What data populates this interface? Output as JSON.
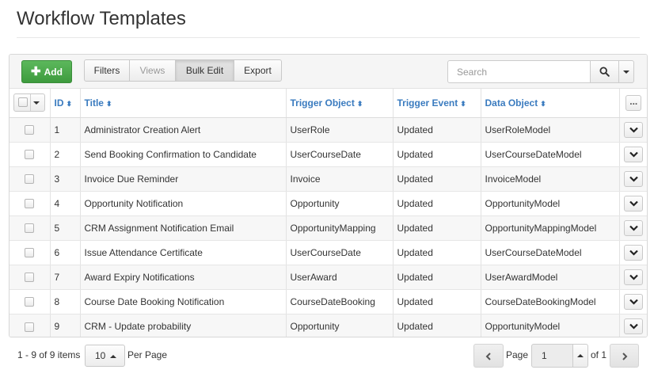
{
  "page": {
    "title": "Workflow Templates"
  },
  "toolbar": {
    "add_label": "Add",
    "filters_label": "Filters",
    "views_label": "Views",
    "bulk_edit_label": "Bulk Edit",
    "export_label": "Export",
    "search_placeholder": "Search",
    "search_value": "",
    "icons": {
      "add": "plus-icon",
      "search": "search-icon",
      "search_options": "caret-down-icon"
    }
  },
  "table": {
    "columns": [
      "ID",
      "Title",
      "Trigger Object",
      "Trigger Event",
      "Data Object"
    ],
    "more_label": "...",
    "rows": [
      {
        "id": "1",
        "title": "Administrator Creation Alert",
        "trigger_object": "UserRole",
        "trigger_event": "Updated",
        "data_object": "UserRoleModel"
      },
      {
        "id": "2",
        "title": "Send Booking Confirmation to Candidate",
        "trigger_object": "UserCourseDate",
        "trigger_event": "Updated",
        "data_object": "UserCourseDateModel"
      },
      {
        "id": "3",
        "title": "Invoice Due Reminder",
        "trigger_object": "Invoice",
        "trigger_event": "Updated",
        "data_object": "InvoiceModel"
      },
      {
        "id": "4",
        "title": "Opportunity Notification",
        "trigger_object": "Opportunity",
        "trigger_event": "Updated",
        "data_object": "OpportunityModel"
      },
      {
        "id": "5",
        "title": "CRM Assignment Notification Email",
        "trigger_object": "OpportunityMapping",
        "trigger_event": "Updated",
        "data_object": "OpportunityMappingModel"
      },
      {
        "id": "6",
        "title": "Issue Attendance Certificate",
        "trigger_object": "UserCourseDate",
        "trigger_event": "Updated",
        "data_object": "UserCourseDateModel"
      },
      {
        "id": "7",
        "title": "Award Expiry Notifications",
        "trigger_object": "UserAward",
        "trigger_event": "Updated",
        "data_object": "UserAwardModel"
      },
      {
        "id": "8",
        "title": "Course Date Booking Notification",
        "trigger_object": "CourseDateBooking",
        "trigger_event": "Updated",
        "data_object": "CourseDateBookingModel"
      },
      {
        "id": "9",
        "title": "CRM - Update probability",
        "trigger_object": "Opportunity",
        "trigger_event": "Updated",
        "data_object": "OpportunityModel"
      }
    ]
  },
  "footer": {
    "count_text": "1 - 9 of 9 items",
    "per_page_value": "10",
    "per_page_label": "Per Page",
    "page_label": "Page",
    "page_value": "1",
    "of_label": "of 1"
  },
  "colors": {
    "accent": "#3a7bbf",
    "add_button": "#4cae4c",
    "row_stripe": "#f7f7f7"
  }
}
